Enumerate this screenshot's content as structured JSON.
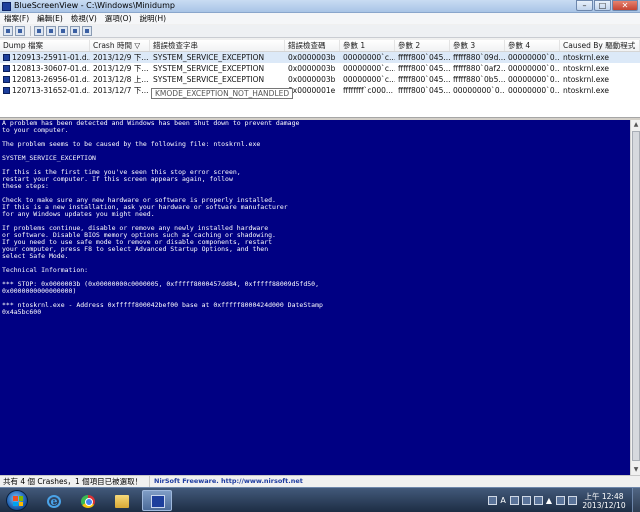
{
  "window": {
    "title": "BlueScreenView  -  C:\\Windows\\Minidump",
    "buttons": {
      "minimize": "–",
      "maximize": "□",
      "close": "✕"
    }
  },
  "menubar": [
    "檔案(F)",
    "編輯(E)",
    "檢視(V)",
    "選項(O)",
    "說明(H)"
  ],
  "toolbar": [
    "open-icon",
    "save-icon",
    "copy-icon",
    "properties-icon",
    "refresh-icon",
    "find-icon",
    "exit-icon"
  ],
  "table": {
    "columns": [
      "Dump 檔案",
      "Crash 時間",
      "錯誤檢查字串",
      "錯誤檢查碼",
      "參數 1",
      "參數 2",
      "參數 3",
      "參數 4",
      "Caused By 驅動程式"
    ],
    "sort_indicator": "▽",
    "rows": [
      [
        "120913-25911-01.d...",
        "2013/12/9 下...",
        "SYSTEM_SERVICE_EXCEPTION",
        "0x0000003b",
        "00000000`c...",
        "fffff800`045...",
        "fffff880`09d...",
        "00000000`0...",
        "ntoskrnl.exe"
      ],
      [
        "120813-30607-01.d...",
        "2013/12/9 下...",
        "SYSTEM_SERVICE_EXCEPTION",
        "0x0000003b",
        "00000000`c...",
        "fffff800`045...",
        "fffff880`0af2...",
        "00000000`0...",
        "ntoskrnl.exe"
      ],
      [
        "120813-26956-01.d...",
        "2013/12/8 上...",
        "SYSTEM_SERVICE_EXCEPTION",
        "0x0000003b",
        "00000000`c...",
        "fffff800`045...",
        "fffff880`0b5...",
        "00000000`0...",
        "ntoskrnl.exe"
      ],
      [
        "120713-31652-01.d...",
        "2013/12/7 下...",
        "",
        "0x0000001e",
        "ffffffff`c000...",
        "fffff800`045...",
        "00000000`0...",
        "00000000`0...",
        "ntoskrnl.exe"
      ]
    ]
  },
  "tooltip": "KMODE_EXCEPTION_NOT_HANDLED",
  "bsod_lines": [
    "A problem has been detected and Windows has been shut down to prevent damage",
    "to your computer.",
    "",
    "The problem seems to be caused by the following file: ntoskrnl.exe",
    "",
    "SYSTEM_SERVICE_EXCEPTION",
    "",
    "If this is the first time you've seen this stop error screen,",
    "restart your computer. If this screen appears again, follow",
    "these steps:",
    "",
    "Check to make sure any new hardware or software is properly installed.",
    "If this is a new installation, ask your hardware or software manufacturer",
    "for any Windows updates you might need.",
    "",
    "If problems continue, disable or remove any newly installed hardware",
    "or software. Disable BIOS memory options such as caching or shadowing.",
    "If you need to use safe mode to remove or disable components, restart",
    "your computer, press F8 to select Advanced Startup Options, and then",
    "select Safe Mode.",
    "",
    "Technical Information:",
    "",
    "*** STOP: 0x0000003b (0x00000000c0000005, 0xfffff8000457dd84, 0xfffff88009d5fd50,",
    "0x0000000000000000)",
    "",
    "*** ntoskrnl.exe - Address 0xfffff800042bef00 base at 0xfffff8000424d000 DateStamp",
    "0x4a5bc600"
  ],
  "statusbar": {
    "left": "共有 4 個 Crashes，1 個項目已被選取！",
    "right": "NirSoft Freeware.  http://www.nirsoft.net"
  },
  "taskbar": {
    "apps": [
      "internet-explorer-icon",
      "chrome-icon",
      "file-explorer-icon",
      "bluescreenview-icon"
    ],
    "tray_lang": "A",
    "clock_time": "上午 12:48",
    "clock_date": "2013/12/10"
  }
}
